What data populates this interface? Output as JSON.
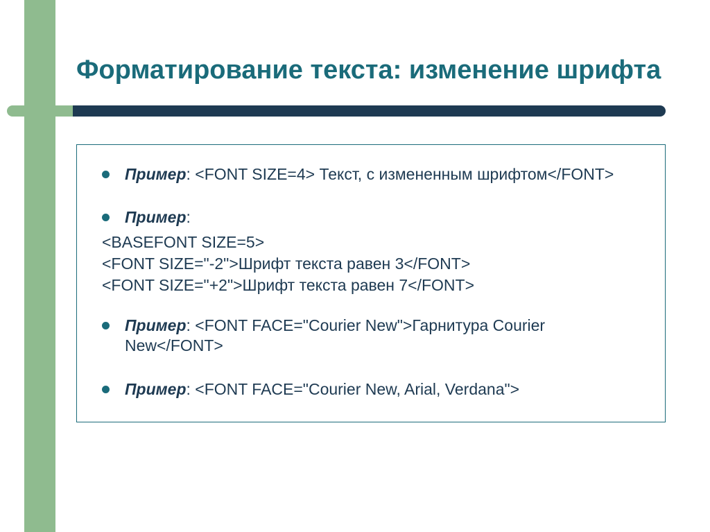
{
  "title": "Форматирование текста: изменение шрифта",
  "items": {
    "ex1": {
      "label": "Пример",
      "text": ": <FONT SIZE=4> Текст, с измененным шрифтом</FONT>"
    },
    "ex2": {
      "label": "Пример",
      "colon": ":",
      "line1": "<BASEFONT SIZE=5>",
      "line2": "<FONT SIZE=\"-2\">Шрифт текста равен 3</FONT>",
      "line3": "<FONT SIZE=\"+2\">Шрифт текста равен 7</FONT>"
    },
    "ex3": {
      "label": "Пример",
      "text": ": <FONT FACE=\"Courier New\">Гарнитура Courier New</FONT>"
    },
    "ex4": {
      "label": "Пример",
      "text": ": <FONT FACE=\"Courier New, Arial, Verdana\">"
    }
  }
}
